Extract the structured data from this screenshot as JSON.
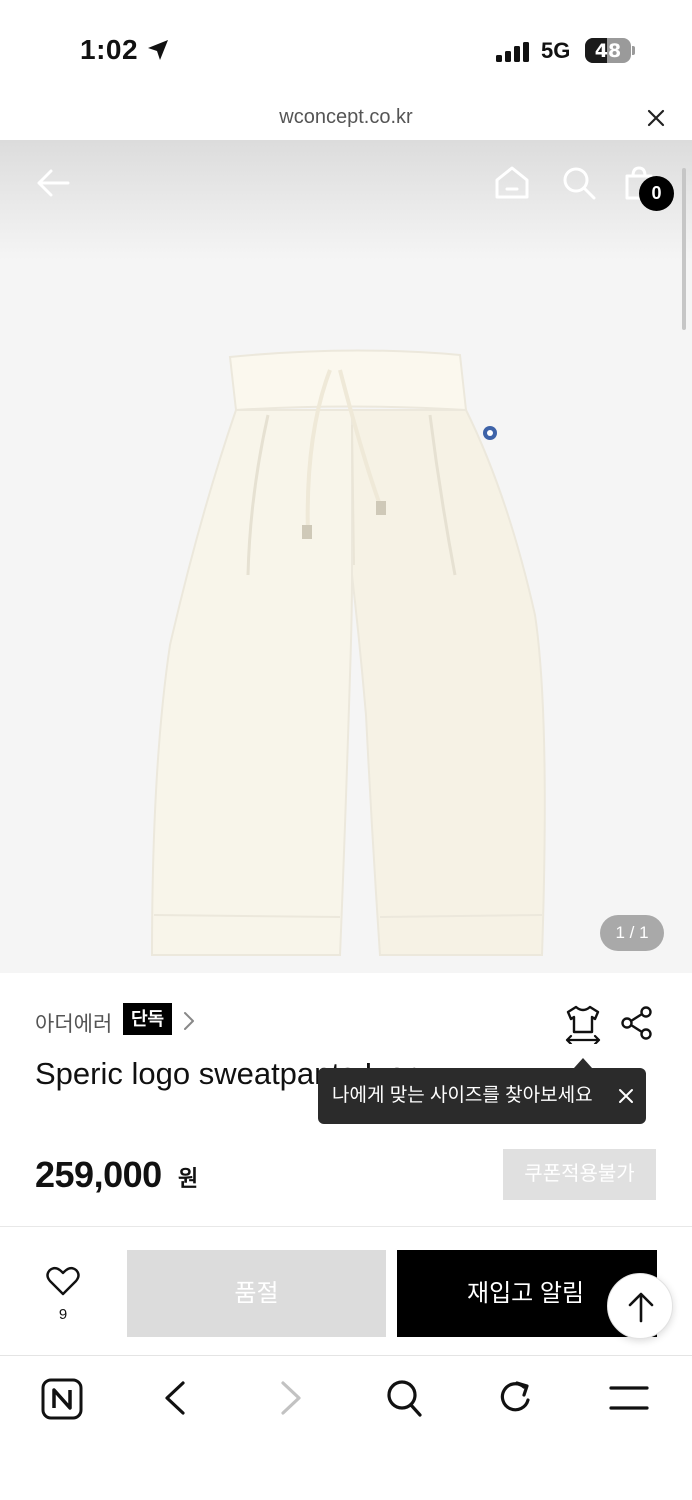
{
  "status_bar": {
    "time": "1:02",
    "network": "5G",
    "battery": "48",
    "battery_level": 0.48
  },
  "browser": {
    "url": "wconcept.co.kr"
  },
  "header": {
    "cart_count": "0"
  },
  "gallery": {
    "pager": "1 / 1"
  },
  "product": {
    "brand": "아더에러",
    "exclusive_badge": "단독",
    "title": "Speric logo sweatpants Ivory",
    "price": "259,000",
    "currency": "원",
    "coupon_label": "쿠폰적용불가"
  },
  "tooltip": {
    "text": "나에게 맞는 사이즈를 찾아보세요"
  },
  "actions": {
    "like_count": "9",
    "soldout_label": "품절",
    "restock_label": "재입고 알림"
  },
  "colors": {
    "accent": "#000000",
    "disabled": "#dcdcdc",
    "tooltip_bg": "#2b2b2b"
  },
  "icons": [
    "location-arrow-icon",
    "signal-icon",
    "close-icon",
    "back-arrow-icon",
    "home-icon",
    "search-icon",
    "shopping-bag-icon",
    "chevron-right-icon",
    "size-guide-icon",
    "share-icon",
    "heart-icon",
    "arrow-up-icon",
    "naver-icon",
    "refresh-icon",
    "menu-icon"
  ]
}
